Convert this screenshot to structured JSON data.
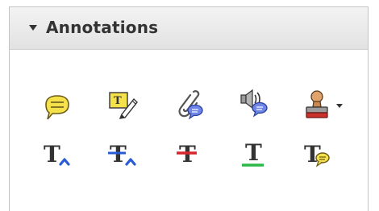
{
  "panel": {
    "title": "Annotations",
    "tools": {
      "sticky_note": "sticky-note-icon",
      "text_callout": "text-box-edit-icon",
      "attach_file": "paperclip-note-icon",
      "record_audio": "speaker-note-icon",
      "stamp": "stamp-icon",
      "insert_text": "insert-text-icon",
      "replace_text": "replace-text-icon",
      "strikethrough": "strikethrough-icon",
      "underline": "underline-icon",
      "add_note_to_text": "text-note-icon"
    },
    "colors": {
      "note_yellow": "#f5e24a",
      "accent_blue": "#2a5bd7",
      "strike_red": "#d9262c",
      "underline_green": "#2db84a",
      "stamp_red": "#c8322a"
    }
  }
}
